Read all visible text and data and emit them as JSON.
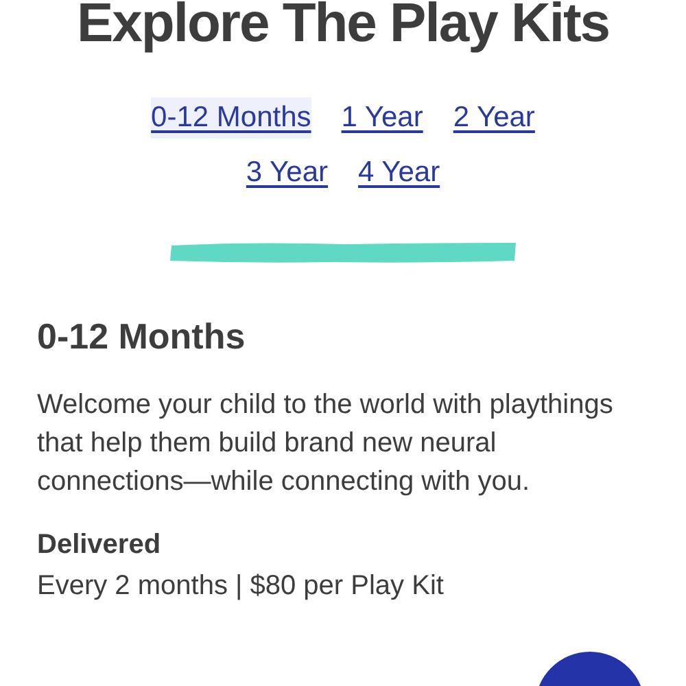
{
  "title": "Explore The Play Kits",
  "tabs": [
    {
      "label": "0-12 Months",
      "selected": true
    },
    {
      "label": "1 Year",
      "selected": false
    },
    {
      "label": "2 Year",
      "selected": false
    },
    {
      "label": "3 Year",
      "selected": false
    },
    {
      "label": "4 Year",
      "selected": false
    }
  ],
  "section": {
    "heading": "0-12 Months",
    "description": "Welcome your child to the world with playthings that help them build brand new neural connections—while connecting with you.",
    "delivery_label": "Delivered",
    "delivery_detail": "Every 2 months | $80 per Play Kit"
  }
}
